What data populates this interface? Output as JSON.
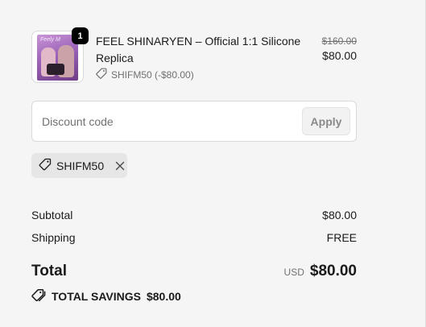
{
  "product": {
    "quantity": "1",
    "title": "FEEL SHINARYEN – Official 1:1 Silicone Replica",
    "thumb_title": "Feely M",
    "discount_code": "SHIFM50 (-$80.00)",
    "original_price": "$160.00",
    "price": "$80.00"
  },
  "discount": {
    "placeholder": "Discount code",
    "apply_label": "Apply"
  },
  "applied_code": {
    "code": "SHIFM50"
  },
  "summary": {
    "subtotal_label": "Subtotal",
    "subtotal_value": "$80.00",
    "shipping_label": "Shipping",
    "shipping_value": "FREE",
    "total_label": "Total",
    "total_currency": "USD",
    "total_value": "$80.00",
    "savings_label": "TOTAL SAVINGS",
    "savings_value": "$80.00"
  },
  "icons": {
    "tag": "tag-icon",
    "close": "close-icon",
    "savings": "savings-tag-icon"
  }
}
